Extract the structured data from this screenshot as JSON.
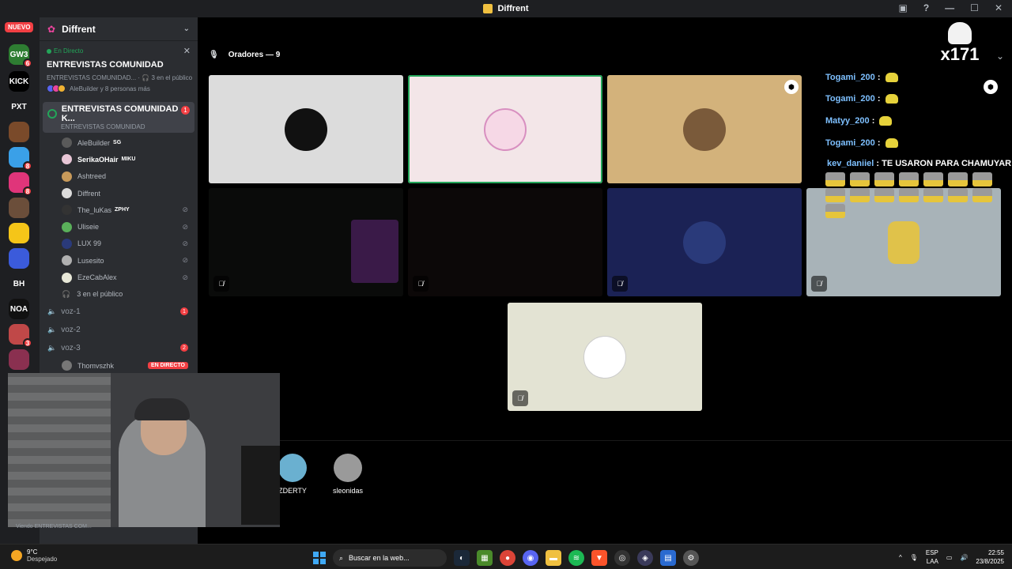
{
  "window": {
    "title": "Diffrent"
  },
  "rail": {
    "new_label": "NUEVO",
    "items": [
      {
        "text": "GW3",
        "color": "#2e7d32",
        "badge": "6"
      },
      {
        "text": "KICK",
        "color": "#000000",
        "badge": ""
      },
      {
        "text": "PXT",
        "color": "#1e1f22",
        "badge": ""
      },
      {
        "text": "",
        "color": "#7a4a2a",
        "badge": ""
      },
      {
        "text": "",
        "color": "#3aa0e8",
        "badge": "8"
      },
      {
        "text": "",
        "color": "#e0357a",
        "badge": "8"
      },
      {
        "text": "",
        "color": "#6b4e3a",
        "badge": ""
      },
      {
        "text": "",
        "color": "#f5c518",
        "badge": ""
      },
      {
        "text": "",
        "color": "#3b5bdb",
        "badge": ""
      },
      {
        "text": "BH",
        "color": "#1e1f22",
        "badge": ""
      },
      {
        "text": "NOA",
        "color": "#111111",
        "badge": ""
      },
      {
        "text": "",
        "color": "#c04848",
        "badge": "3"
      },
      {
        "text": "",
        "color": "#8a3050",
        "badge": ""
      }
    ]
  },
  "sidebar": {
    "server_name": "Diffrent",
    "live": {
      "status": "En Directo",
      "title": "ENTREVISTAS COMUNIDAD",
      "subtitle": "ENTREVISTAS COMUNIDAD...",
      "audience": "3 en el público",
      "people": "AleBuilder y 8 personas más"
    },
    "active_channel": {
      "name": "ENTREVISTAS COMUNIDAD K...",
      "sub": "ENTREVISTAS COMUNIDAD",
      "badge": "1"
    },
    "members": [
      {
        "name": "AleBuilder",
        "tag": "SG",
        "color": "#5a5a5a",
        "muted": false,
        "bright": false
      },
      {
        "name": "SerikaOHair",
        "tag": "MIKU",
        "color": "#e8c6d6",
        "muted": false,
        "bright": true
      },
      {
        "name": "Ashtreed",
        "tag": "",
        "color": "#c89a5a",
        "muted": false,
        "bright": false
      },
      {
        "name": "Diffrent",
        "tag": "",
        "color": "#dcdcdc",
        "muted": false,
        "bright": false
      },
      {
        "name": "The_luKas",
        "tag": "ZPHY",
        "color": "#333333",
        "muted": true,
        "bright": false
      },
      {
        "name": "Uliseie",
        "tag": "",
        "color": "#5ab05a",
        "muted": true,
        "bright": false
      },
      {
        "name": "LUX 99",
        "tag": "",
        "color": "#2a3a7a",
        "muted": true,
        "bright": false
      },
      {
        "name": "Lusesito",
        "tag": "",
        "color": "#b0b0b0",
        "muted": true,
        "bright": false
      },
      {
        "name": "EzeCabAlex",
        "tag": "",
        "color": "#e8e8d8",
        "muted": true,
        "bright": false
      }
    ],
    "audience_row": "3 en el público",
    "voice_channels": [
      {
        "name": "voz-1",
        "badge": "1"
      },
      {
        "name": "voz-2",
        "badge": ""
      },
      {
        "name": "voz-3",
        "badge": "2"
      }
    ],
    "streamer": {
      "name": "Thomvszhk",
      "badge": "EN DIRECTO"
    },
    "viewing": "Viendo ENTREVISTAS COM..."
  },
  "stage": {
    "speakers_label": "Oradores — 9",
    "chat": [
      {
        "user": "Togami_200",
        "sep": " :"
      },
      {
        "user": "Togami_200",
        "sep": " :"
      },
      {
        "user": "Matyy_200",
        "sep": " :"
      },
      {
        "user": "Togami_200",
        "sep": " :"
      },
      {
        "user": "kev_daniiel",
        "sep": " : TE USARON PARA CHAMUYAR"
      }
    ],
    "overlay_logo": "x171",
    "audience": [
      {
        "name": "ZDERTY",
        "color": "#6ab0d0"
      },
      {
        "name": "sleonidas",
        "color": "#9a9a9a"
      }
    ]
  },
  "taskbar": {
    "temp": "9°C",
    "weather": "Despejado",
    "search_placeholder": "Buscar en la web...",
    "lang": "ESP",
    "lang2": "LAA",
    "time": "22:55",
    "date": "23/8/2025"
  }
}
